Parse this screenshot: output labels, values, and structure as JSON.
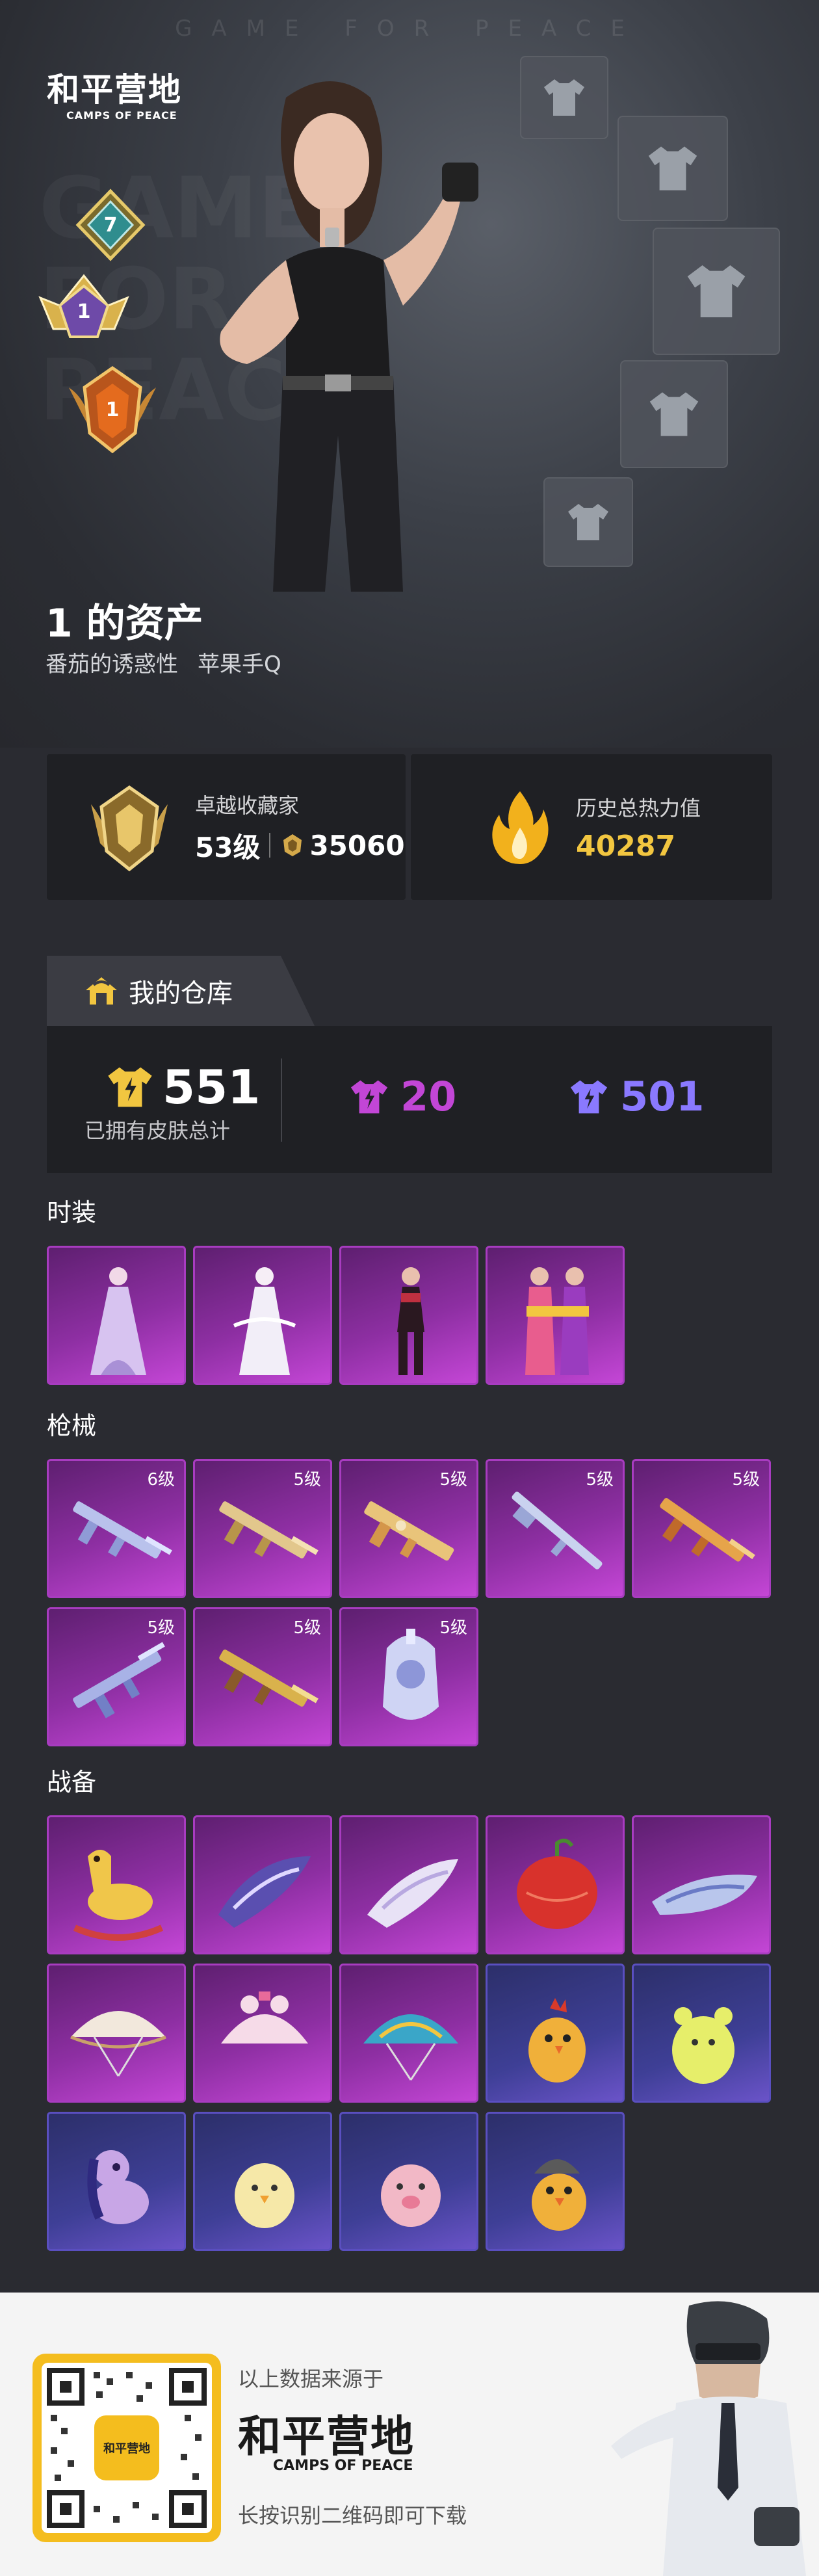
{
  "hero": {
    "tagline": "GAME FOR PEACE",
    "watermark": [
      "GAME",
      "FOR",
      "PEACE"
    ],
    "brand_cn": "和平营地",
    "brand_en": "CAMPS OF PEACE",
    "badges": [
      "7",
      "1",
      "1"
    ],
    "title": "1 的资产",
    "subtitle_name": "番茄的诱惑性",
    "subtitle_platform": "苹果手Q"
  },
  "stats": {
    "collector_label": "卓越收藏家",
    "collector_level": "53级",
    "collector_points": "35060",
    "heat_label": "历史总热力值",
    "heat_value": "40287"
  },
  "warehouse": {
    "title": "我的仓库",
    "total": "551",
    "total_label": "已拥有皮肤总计",
    "purple_count": "20",
    "blue_count": "501",
    "colors": {
      "gold": "#f2c640",
      "purple": "#c246d6",
      "blue": "#8a79ff"
    }
  },
  "sections": {
    "outfits": "时装",
    "guns": "枪械",
    "gear": "战备"
  },
  "guns": {
    "levels": [
      "6级",
      "5级",
      "5级",
      "5级",
      "5级",
      "5级",
      "5级",
      "5级"
    ]
  },
  "footer": {
    "source": "以上数据来源于",
    "brand_cn": "和平营地",
    "brand_en": "CAMPS OF PEACE",
    "hint": "长按识别二维码即可下载",
    "qr_app_label": "和平营地"
  }
}
